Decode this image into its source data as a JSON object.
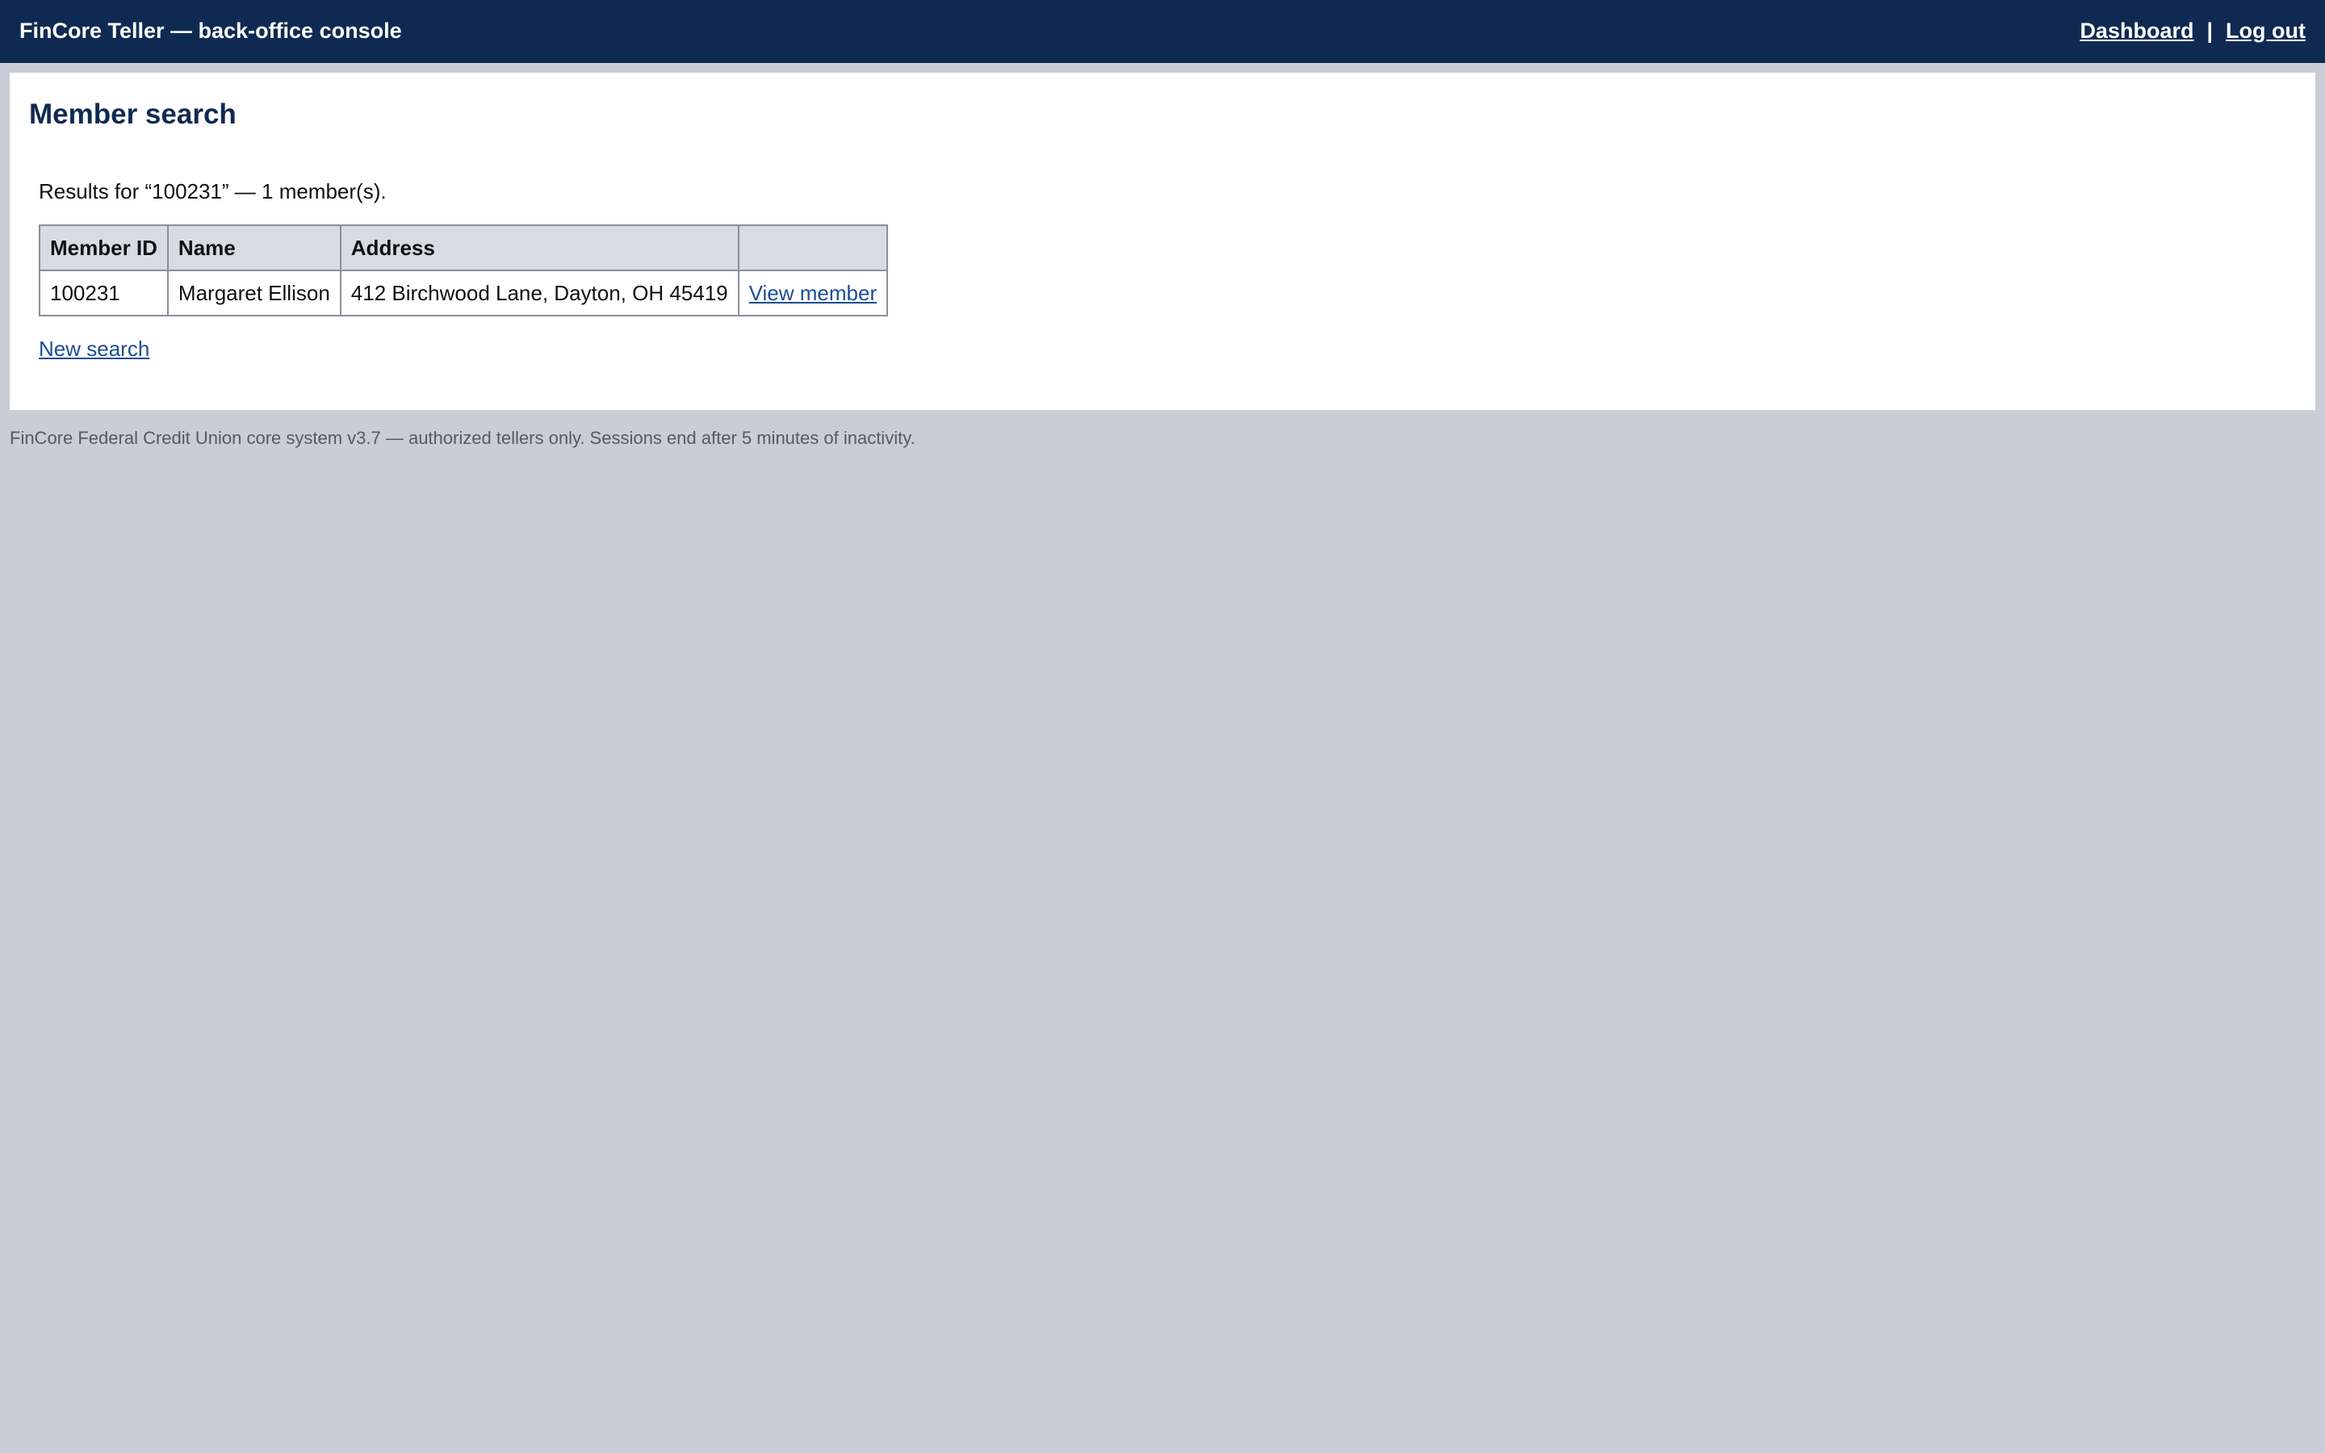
{
  "header": {
    "app_title": "FinCore Teller — back-office console",
    "nav": {
      "dashboard": "Dashboard",
      "separator": "|",
      "logout": "Log out"
    }
  },
  "main": {
    "page_title": "Member search",
    "results_text": "Results for “100231” — 1 member(s).",
    "table": {
      "headers": [
        "Member ID",
        "Name",
        "Address",
        ""
      ],
      "rows": [
        {
          "member_id": "100231",
          "name": "Margaret Ellison",
          "address": "412 Birchwood Lane, Dayton, OH 45419",
          "action": "View member"
        }
      ]
    },
    "new_search": "New search"
  },
  "footer": {
    "text": "FinCore Federal Credit Union core system v3.7 — authorized tellers only. Sessions end after 5 minutes of inactivity."
  },
  "colors": {
    "header_bg": "#0f2a52",
    "page_bg": "#c8cdd6",
    "link": "#1a4e93",
    "table_header_bg": "#d6dbe4"
  }
}
